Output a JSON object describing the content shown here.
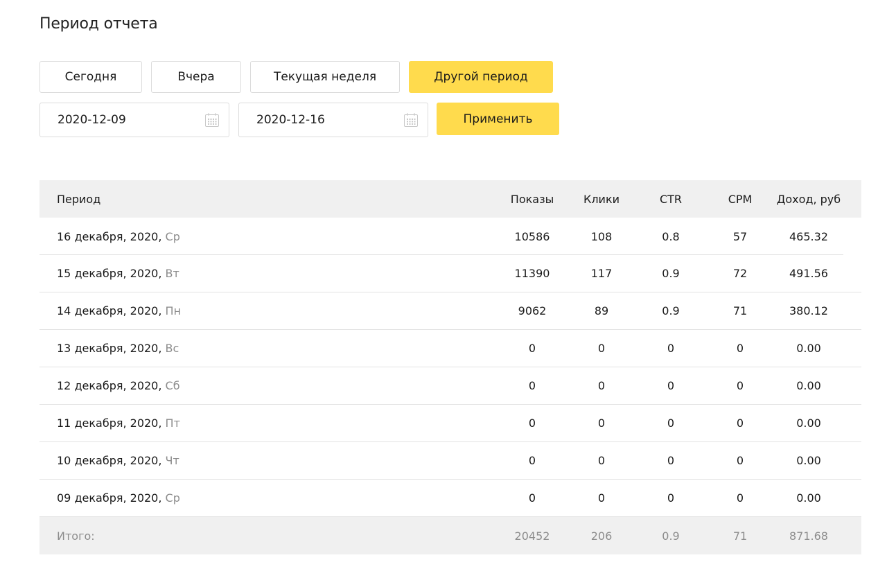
{
  "page_title": "Период отчета",
  "period_buttons": {
    "today": "Сегодня",
    "yesterday": "Вчера",
    "current_week": "Текущая неделя",
    "other_period": "Другой период"
  },
  "date_from": "2020-12-09",
  "date_to": "2020-12-16",
  "apply_label": "Применить",
  "accent_color": "#ffdb4d",
  "table": {
    "headers": {
      "period": "Период",
      "shows": "Показы",
      "clicks": "Клики",
      "ctr": "CTR",
      "cpm": "CPM",
      "income": "Доход, руб"
    },
    "rows": [
      {
        "date": "16 декабря, 2020,",
        "dow": "Ср",
        "shows": "10586",
        "clicks": "108",
        "ctr": "0.8",
        "cpm": "57",
        "income": "465.32"
      },
      {
        "date": "15 декабря, 2020,",
        "dow": "Вт",
        "shows": "11390",
        "clicks": "117",
        "ctr": "0.9",
        "cpm": "72",
        "income": "491.56"
      },
      {
        "date": "14 декабря, 2020,",
        "dow": "Пн",
        "shows": "9062",
        "clicks": "89",
        "ctr": "0.9",
        "cpm": "71",
        "income": "380.12"
      },
      {
        "date": "13 декабря, 2020,",
        "dow": "Вс",
        "shows": "0",
        "clicks": "0",
        "ctr": "0",
        "cpm": "0",
        "income": "0.00"
      },
      {
        "date": "12 декабря, 2020,",
        "dow": "Сб",
        "shows": "0",
        "clicks": "0",
        "ctr": "0",
        "cpm": "0",
        "income": "0.00"
      },
      {
        "date": "11 декабря, 2020,",
        "dow": "Пт",
        "shows": "0",
        "clicks": "0",
        "ctr": "0",
        "cpm": "0",
        "income": "0.00"
      },
      {
        "date": "10 декабря, 2020,",
        "dow": "Чт",
        "shows": "0",
        "clicks": "0",
        "ctr": "0",
        "cpm": "0",
        "income": "0.00"
      },
      {
        "date": "09 декабря, 2020,",
        "dow": "Ср",
        "shows": "0",
        "clicks": "0",
        "ctr": "0",
        "cpm": "0",
        "income": "0.00"
      }
    ],
    "total": {
      "label": "Итого:",
      "shows": "20452",
      "clicks": "206",
      "ctr": "0.9",
      "cpm": "71",
      "income": "871.68"
    }
  }
}
